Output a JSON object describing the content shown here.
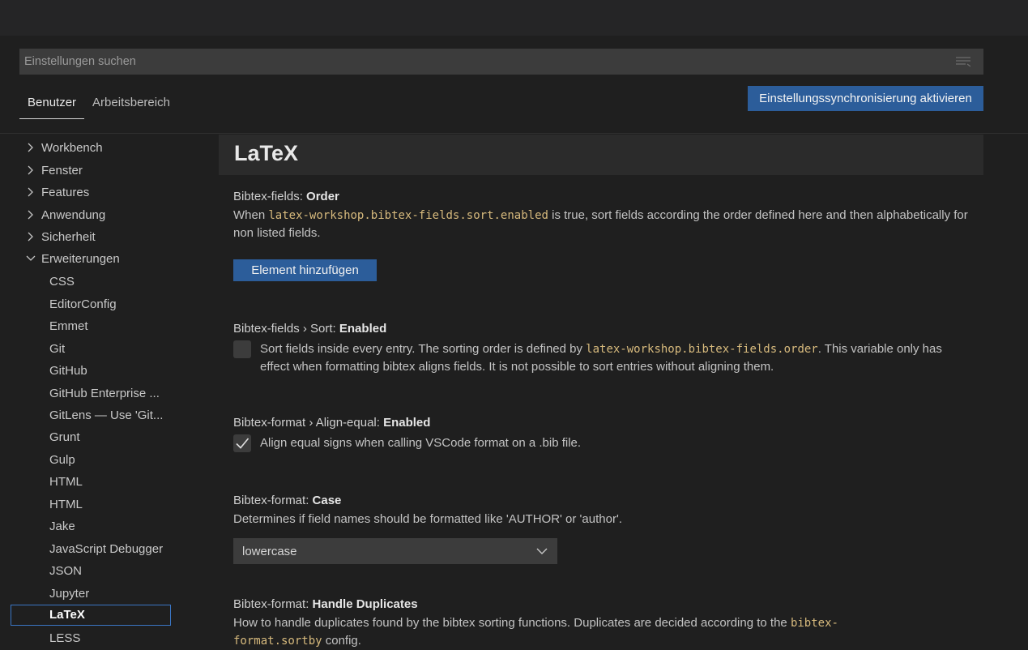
{
  "search": {
    "placeholder": "Einstellungen suchen"
  },
  "tabs": [
    {
      "label": "Benutzer",
      "active": true
    },
    {
      "label": "Arbeitsbereich",
      "active": false
    }
  ],
  "sync_button": "Einstellungssynchronisierung aktivieren",
  "sidebar": {
    "groups": [
      {
        "label": "Workbench",
        "expanded": false
      },
      {
        "label": "Fenster",
        "expanded": false
      },
      {
        "label": "Features",
        "expanded": false
      },
      {
        "label": "Anwendung",
        "expanded": false
      },
      {
        "label": "Sicherheit",
        "expanded": false
      },
      {
        "label": "Erweiterungen",
        "expanded": true
      }
    ],
    "children": [
      "CSS",
      "EditorConfig",
      "Emmet",
      "Git",
      "GitHub",
      "GitHub Enterprise ...",
      "GitLens — Use 'Git...",
      "Grunt",
      "Gulp",
      "HTML",
      "HTML",
      "Jake",
      "JavaScript Debugger",
      "JSON",
      "Jupyter",
      "LaTeX",
      "LESS"
    ],
    "selected": "LaTeX"
  },
  "section": {
    "title": "LaTeX"
  },
  "settings": {
    "order": {
      "prefix": "Bibtex-fields: ",
      "name": "Order",
      "desc_1": "When ",
      "code_1": "latex-workshop.bibtex-fields.sort.enabled",
      "desc_2": " is true, sort fields according the order defined here and then alphabetically for non listed fields.",
      "button": "Element hinzufügen"
    },
    "sort_enabled": {
      "prefix": "Bibtex-fields › Sort: ",
      "name": "Enabled",
      "checked": false,
      "desc_1": "Sort fields inside every entry. The sorting order is defined by ",
      "code_1": "latex-workshop.bibtex-fields.order",
      "desc_2": ". This variable only has effect when formatting bibtex aligns fields. It is not possible to sort entries without aligning them."
    },
    "align_equal": {
      "prefix": "Bibtex-format › Align-equal: ",
      "name": "Enabled",
      "checked": true,
      "desc": "Align equal signs when calling VSCode format on a .bib file."
    },
    "case": {
      "prefix": "Bibtex-format: ",
      "name": "Case",
      "desc": "Determines if field names should be formatted like 'AUTHOR' or 'author'.",
      "value": "lowercase"
    },
    "duplicates": {
      "prefix": "Bibtex-format: ",
      "name": "Handle Duplicates",
      "desc_1": "How to handle duplicates found by the bibtex sorting functions. Duplicates are decided according to the ",
      "code_1": "bibtex-format.sortby",
      "desc_2": " config."
    }
  },
  "colors": {
    "accent": "#2c5d9a",
    "code": "#d7ba7d",
    "selection_border": "#3a75c4"
  }
}
